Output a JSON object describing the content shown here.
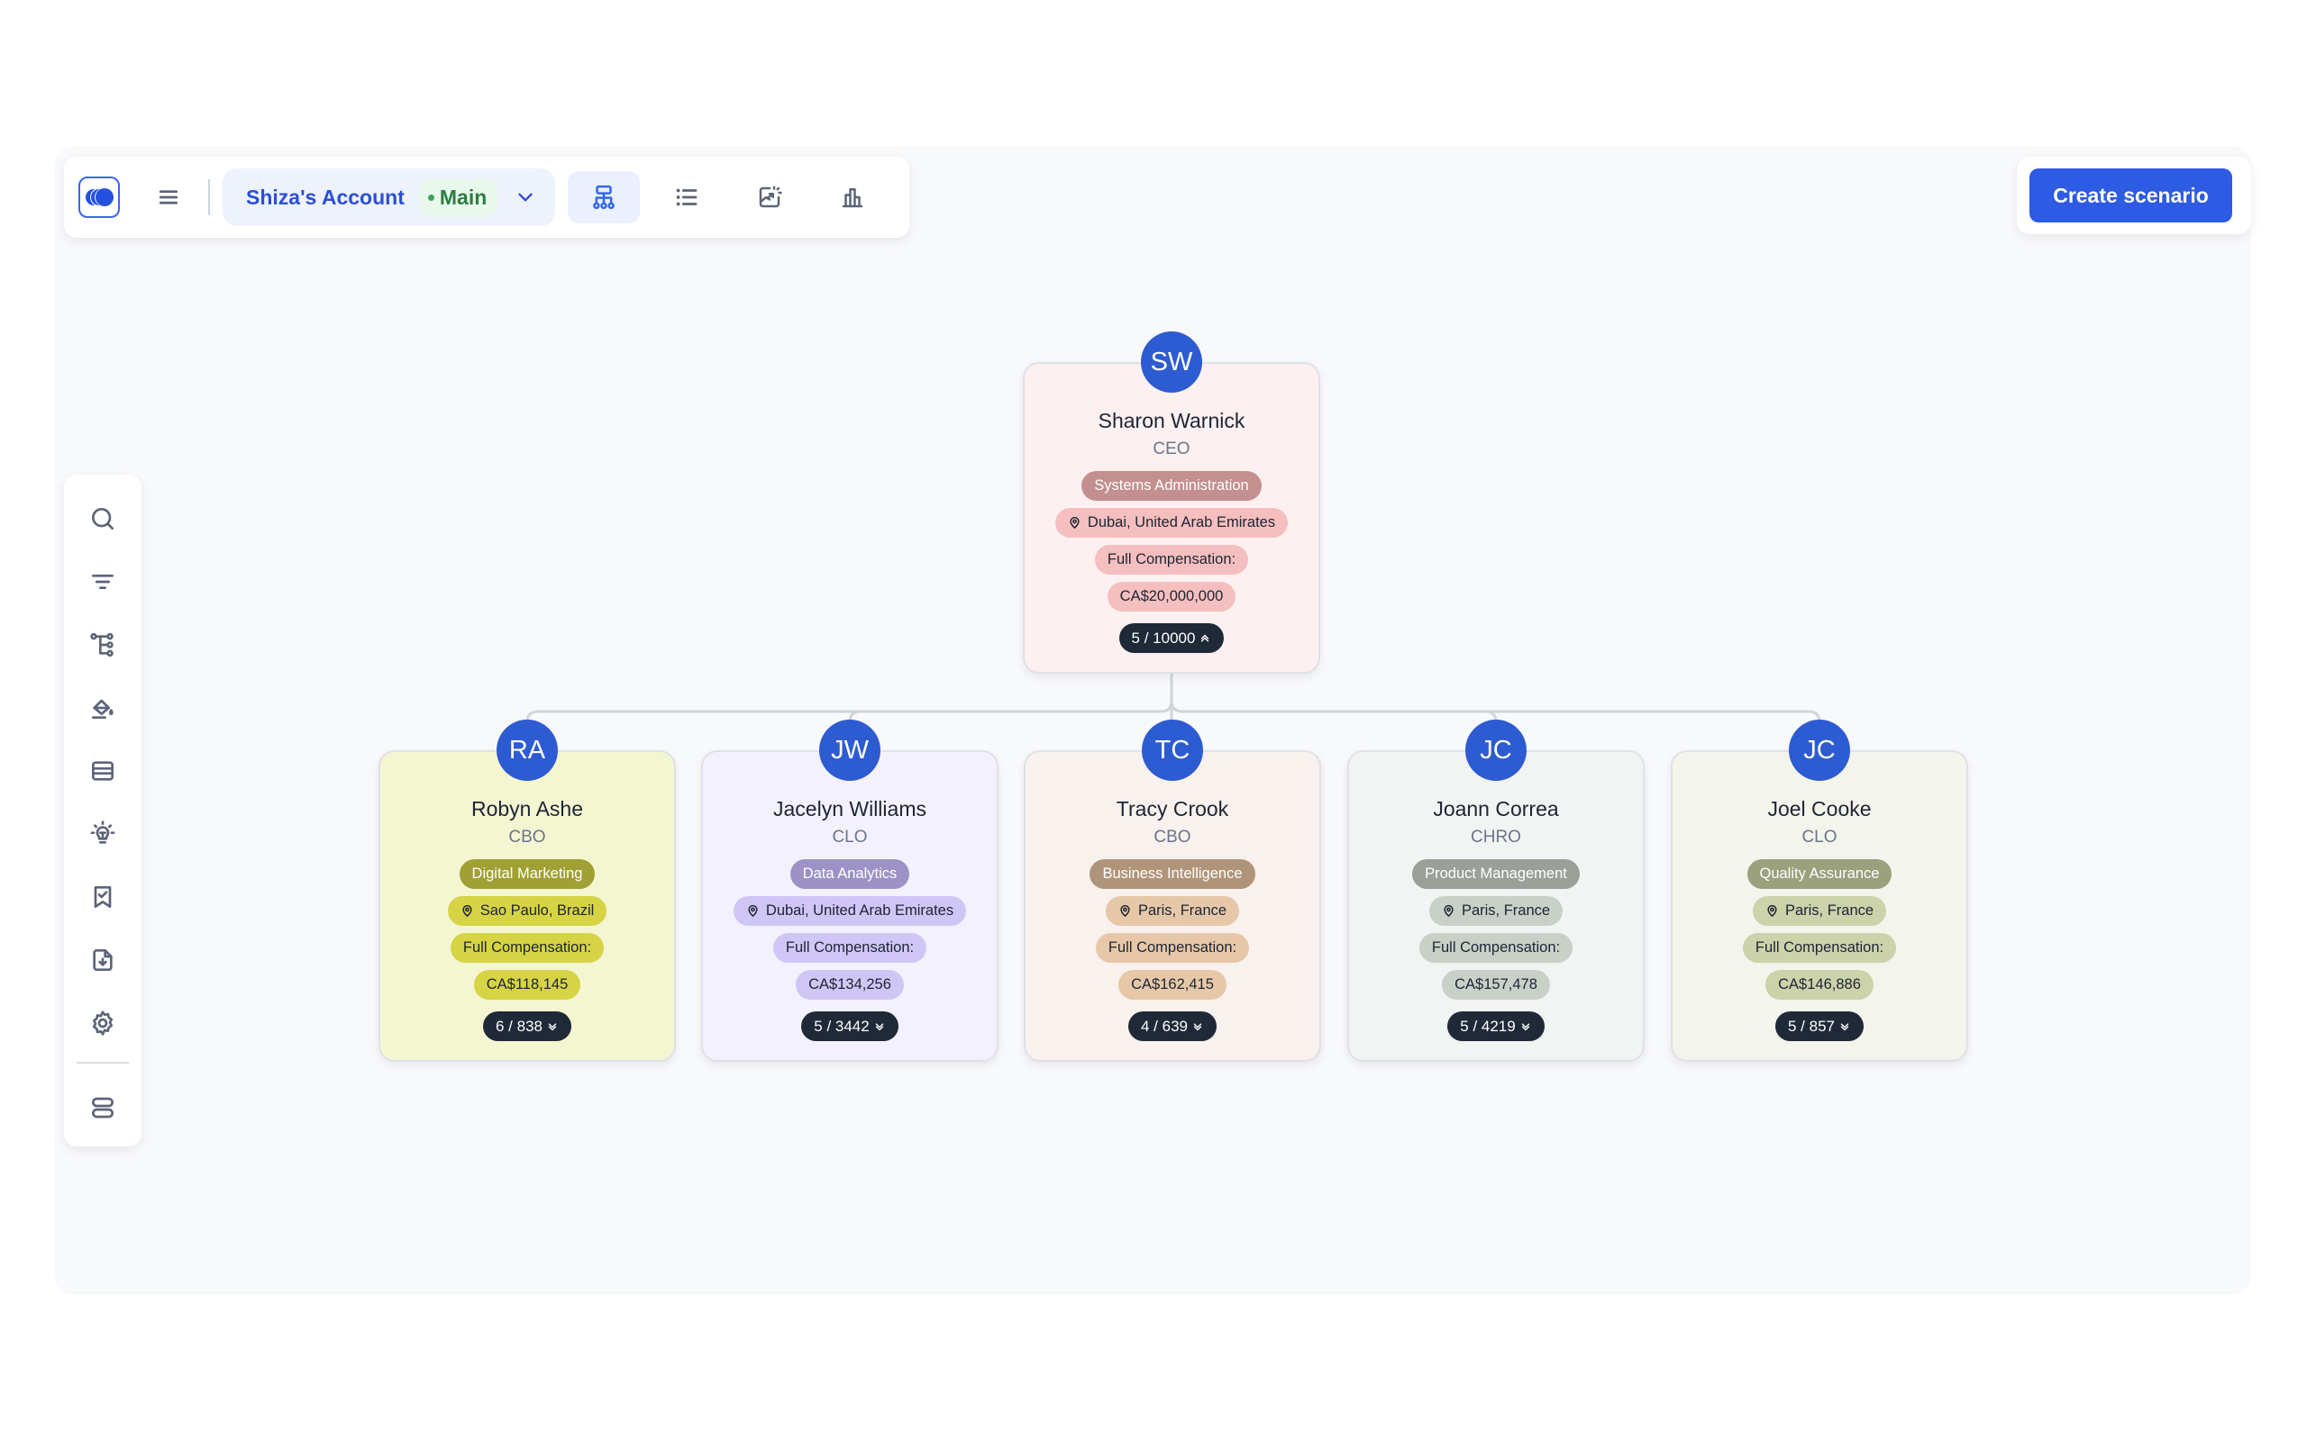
{
  "toolbar": {
    "logo": "app-logo",
    "menu_icon": "hamburger-menu-icon",
    "account_name": "Shiza's Account",
    "branch": "Main",
    "branch_status_color": "#3fa35a",
    "view_buttons": [
      {
        "icon": "org-chart-icon",
        "active": true
      },
      {
        "icon": "list-view-icon",
        "active": false
      },
      {
        "icon": "export-image-icon",
        "active": false
      },
      {
        "icon": "bar-chart-icon",
        "active": false
      }
    ]
  },
  "actions": {
    "create_scenario_label": "Create scenario",
    "accent_color": "#2d5be3"
  },
  "sidebar": {
    "items": [
      {
        "icon": "search-icon"
      },
      {
        "icon": "filter-icon"
      },
      {
        "icon": "hierarchy-icon"
      },
      {
        "icon": "paint-bucket-icon"
      },
      {
        "icon": "table-rows-icon"
      },
      {
        "icon": "lightbulb-icon"
      },
      {
        "icon": "bookmark-check-icon"
      },
      {
        "icon": "file-download-icon"
      },
      {
        "icon": "settings-icon"
      }
    ],
    "bottom_item": {
      "icon": "layout-toggle-icon"
    }
  },
  "org": {
    "root": {
      "initials": "SW",
      "name": "Sharon Warnick",
      "role": "CEO",
      "department": "Systems Administration",
      "location": "Dubai, United Arab Emirates",
      "comp_label": "Full Compensation:",
      "compensation": "CA$20,000,000",
      "reports": "5 / 10000",
      "expanded": true,
      "colors": {
        "card": "#fdf0f0",
        "dept": "#c48f8f",
        "pill": "#f5bfbf"
      }
    },
    "children": [
      {
        "initials": "RA",
        "name": "Robyn Ashe",
        "role": "CBO",
        "department": "Digital Marketing",
        "location": "Sao Paulo, Brazil",
        "comp_label": "Full Compensation:",
        "compensation": "CA$118,145",
        "reports": "6 / 838",
        "expanded": false,
        "colors": {
          "card": "#f4f5d1",
          "dept": "#a0a034",
          "pill": "#d6d444"
        }
      },
      {
        "initials": "JW",
        "name": "Jacelyn Williams",
        "role": "CLO",
        "department": "Data Analytics",
        "location": "Dubai, United Arab Emirates",
        "comp_label": "Full Compensation:",
        "compensation": "CA$134,256",
        "reports": "5 / 3442",
        "expanded": false,
        "colors": {
          "card": "#f3f1fd",
          "dept": "#9d92c6",
          "pill": "#d0c6f6"
        }
      },
      {
        "initials": "TC",
        "name": "Tracy Crook",
        "role": "CBO",
        "department": "Business Intelligence",
        "location": "Paris, France",
        "comp_label": "Full Compensation:",
        "compensation": "CA$162,415",
        "reports": "4 / 639",
        "expanded": false,
        "colors": {
          "card": "#f8f1ed",
          "dept": "#b09479",
          "pill": "#e6c8a9"
        }
      },
      {
        "initials": "JC",
        "name": "Joann Correa",
        "role": "CHRO",
        "department": "Product Management",
        "location": "Paris, France",
        "comp_label": "Full Compensation:",
        "compensation": "CA$157,478",
        "reports": "5 / 4219",
        "expanded": false,
        "colors": {
          "card": "#f2f3f3",
          "dept": "#9a9f98",
          "pill": "#c9d0c7"
        }
      },
      {
        "initials": "JC",
        "name": "Joel Cooke",
        "role": "CLO",
        "department": "Quality Assurance",
        "location": "Paris, France",
        "comp_label": "Full Compensation:",
        "compensation": "CA$146,886",
        "reports": "5 / 857",
        "expanded": false,
        "colors": {
          "card": "#f3f4ec",
          "dept": "#9ba07d",
          "pill": "#ccd2aa"
        }
      }
    ]
  }
}
